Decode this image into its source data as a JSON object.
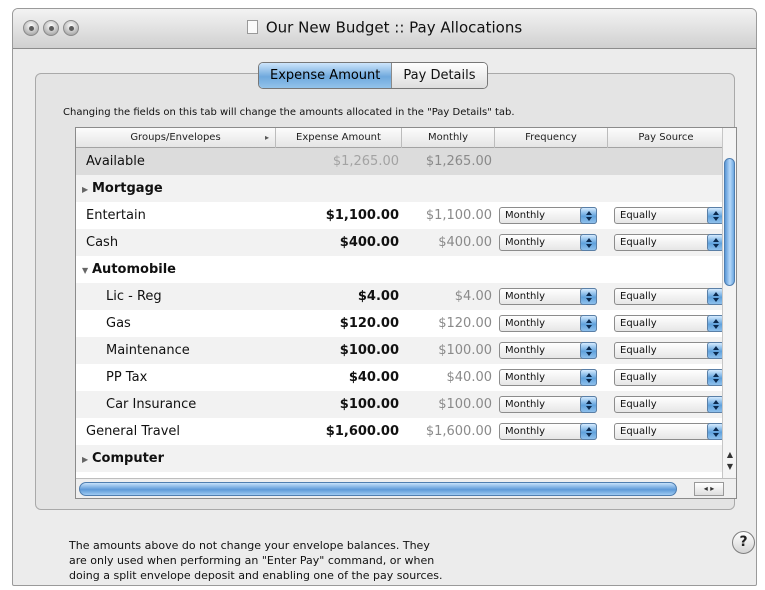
{
  "window": {
    "title": "Our New Budget :: Pay Allocations"
  },
  "tabs": [
    {
      "label": "Expense Amount",
      "active": true
    },
    {
      "label": "Pay Details",
      "active": false
    }
  ],
  "info_text": "Changing the fields on this tab will change the amounts allocated in the \"Pay Details\" tab.",
  "table": {
    "columns": [
      "Groups/Envelopes",
      "Expense Amount",
      "Monthly",
      "Frequency",
      "Pay Source"
    ],
    "rows": [
      {
        "name": "Available",
        "amount": "$1,265.00",
        "monthly": "$1,265.00",
        "frequency": "",
        "source": "",
        "kind": "available"
      },
      {
        "name": "Mortgage",
        "amount": "",
        "monthly": "",
        "frequency": "",
        "source": "",
        "kind": "group-collapsed"
      },
      {
        "name": "Entertain",
        "amount": "$1,100.00",
        "monthly": "$1,100.00",
        "frequency": "Monthly",
        "source": "Equally",
        "kind": "item"
      },
      {
        "name": "Cash",
        "amount": "$400.00",
        "monthly": "$400.00",
        "frequency": "Monthly",
        "source": "Equally",
        "kind": "item"
      },
      {
        "name": "Automobile",
        "amount": "",
        "monthly": "",
        "frequency": "",
        "source": "",
        "kind": "group-expanded"
      },
      {
        "name": "Lic - Reg",
        "amount": "$4.00",
        "monthly": "$4.00",
        "frequency": "Monthly",
        "source": "Equally",
        "kind": "child"
      },
      {
        "name": "Gas",
        "amount": "$120.00",
        "monthly": "$120.00",
        "frequency": "Monthly",
        "source": "Equally",
        "kind": "child"
      },
      {
        "name": "Maintenance",
        "amount": "$100.00",
        "monthly": "$100.00",
        "frequency": "Monthly",
        "source": "Equally",
        "kind": "child"
      },
      {
        "name": "PP Tax",
        "amount": "$40.00",
        "monthly": "$40.00",
        "frequency": "Monthly",
        "source": "Equally",
        "kind": "child"
      },
      {
        "name": "Car Insurance",
        "amount": "$100.00",
        "monthly": "$100.00",
        "frequency": "Monthly",
        "source": "Equally",
        "kind": "child"
      },
      {
        "name": "General Travel",
        "amount": "$1,600.00",
        "monthly": "$1,600.00",
        "frequency": "Monthly",
        "source": "Equally",
        "kind": "item"
      },
      {
        "name": "Computer",
        "amount": "",
        "monthly": "",
        "frequency": "",
        "source": "",
        "kind": "group-collapsed"
      }
    ]
  },
  "icons": {
    "collapsed": "disclosure-triangle-right-icon",
    "expanded": "disclosure-triangle-down-icon",
    "popup": "popup-arrows-icon",
    "help": "help-icon"
  },
  "footer_text": [
    "The amounts above do not change your envelope balances.  They",
    "are only used when performing an \"Enter Pay\" command, or when",
    "doing a split envelope deposit and enabling one of the pay sources."
  ],
  "help_label": "?",
  "colors": {
    "accent": "#5d99d8",
    "window_bg": "#ececec"
  }
}
